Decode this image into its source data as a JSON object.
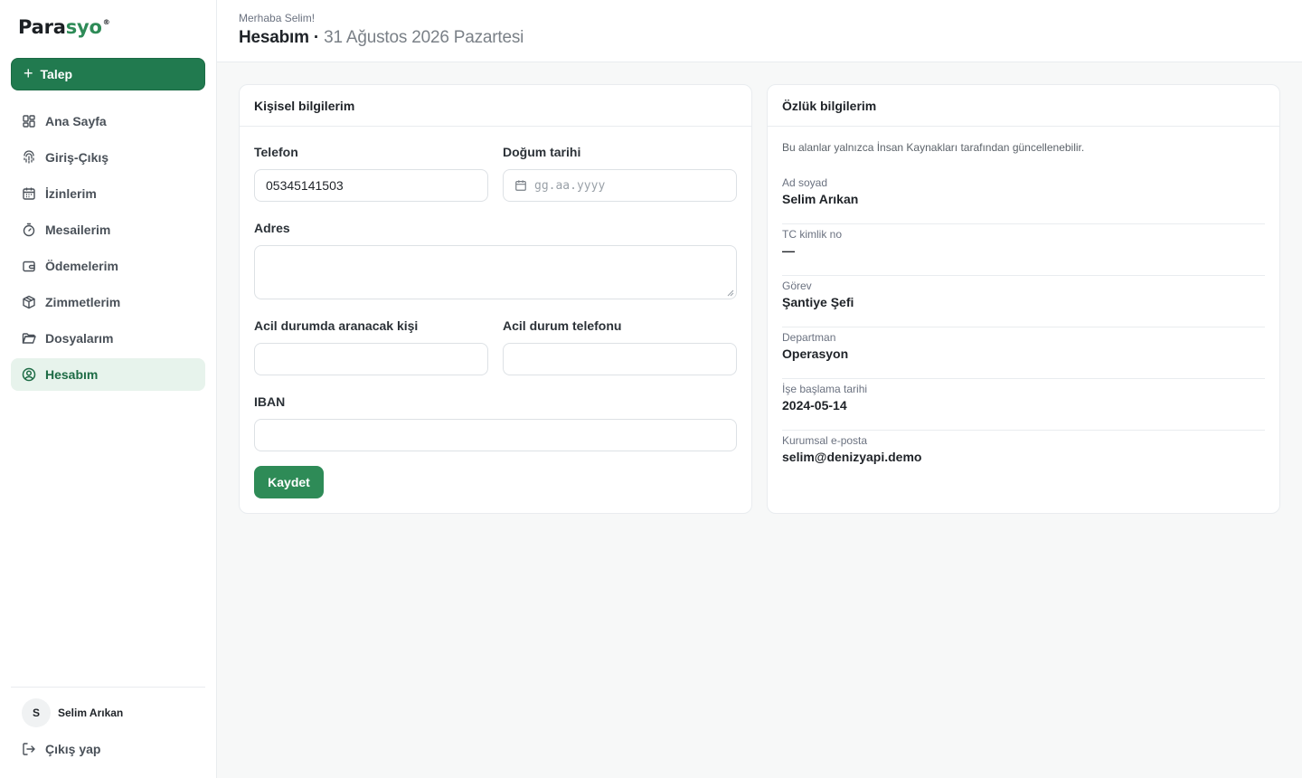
{
  "app": {
    "logo_main": "Para",
    "logo_accent": "syo",
    "logo_mark": "®",
    "primary_color": "#217a4f"
  },
  "sidebar": {
    "new_request_label": "Talep",
    "items": [
      {
        "label": "Ana Sayfa",
        "icon": "dashboard-icon"
      },
      {
        "label": "Giriş-Çıkış",
        "icon": "fingerprint-icon"
      },
      {
        "label": "İzinlerim",
        "icon": "calendar-icon"
      },
      {
        "label": "Mesailerim",
        "icon": "timer-icon"
      },
      {
        "label": "Ödemelerim",
        "icon": "wallet-icon"
      },
      {
        "label": "Zimmetlerim",
        "icon": "package-icon"
      },
      {
        "label": "Dosyalarım",
        "icon": "folder-icon"
      },
      {
        "label": "Hesabım",
        "icon": "user-circle-icon",
        "active": true
      }
    ],
    "user": {
      "initial": "S",
      "name": "Selim Arıkan"
    },
    "logout_label": "Çıkış yap"
  },
  "header": {
    "greeting": "Merhaba Selim!",
    "title": "Hesabım",
    "separator": "·",
    "date": "31 Ağustos 2026 Pazartesi"
  },
  "personal": {
    "title": "Kişisel bilgilerim",
    "phone_label": "Telefon",
    "phone_value": "05345141503",
    "birth_label": "Doğum tarihi",
    "birth_placeholder": "gg.aa.yyyy",
    "address_label": "Adres",
    "address_value": "",
    "emergency_person_label": "Acil durumda aranacak kişi",
    "emergency_person_value": "",
    "emergency_phone_label": "Acil durum telefonu",
    "emergency_phone_value": "",
    "iban_label": "IBAN",
    "iban_value": "",
    "save_label": "Kaydet"
  },
  "employment": {
    "title": "Özlük bilgilerim",
    "note": "Bu alanlar yalnızca İnsan Kaynakları tarafından güncellenebilir.",
    "fields": [
      {
        "label": "Ad soyad",
        "value": "Selim Arıkan"
      },
      {
        "label": "TC kimlik no",
        "value": "—"
      },
      {
        "label": "Görev",
        "value": "Şantiye Şefi"
      },
      {
        "label": "Departman",
        "value": "Operasyon"
      },
      {
        "label": "İşe başlama tarihi",
        "value": "2024-05-14"
      },
      {
        "label": "Kurumsal e-posta",
        "value": "selim@denizyapi.demo"
      }
    ]
  }
}
